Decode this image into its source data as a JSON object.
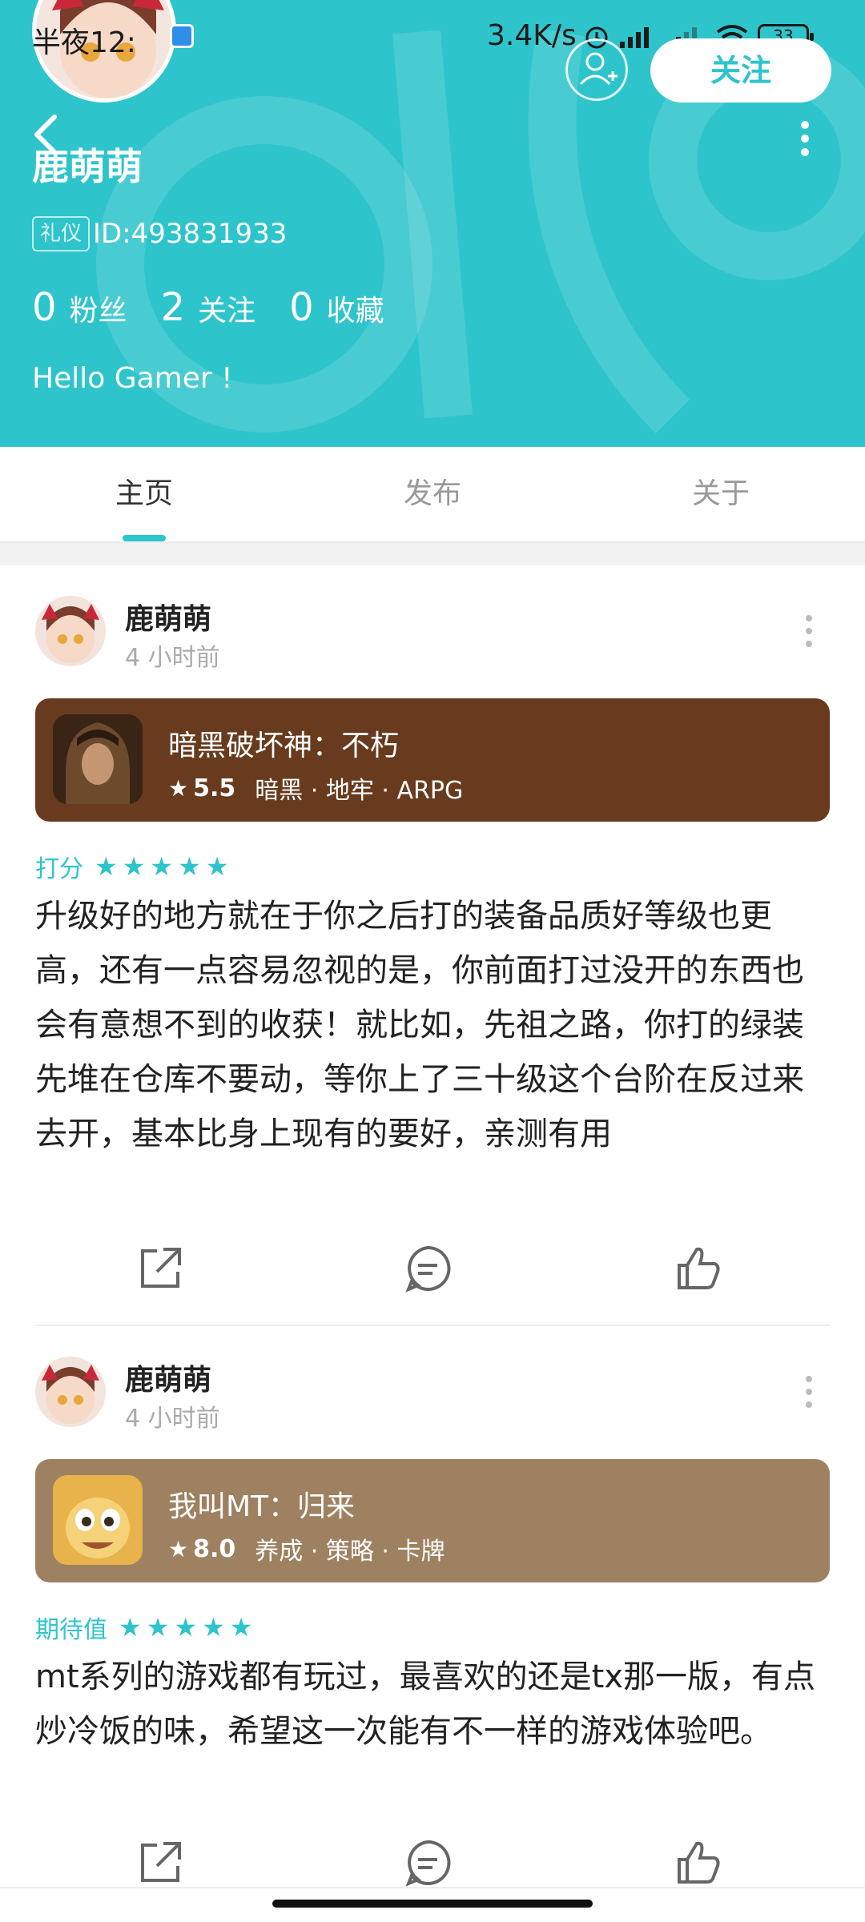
{
  "status_bar": {
    "time": "半夜12:",
    "speed": "3.4K/s",
    "battery": "33"
  },
  "profile": {
    "name": "鹿萌萌",
    "title_badge": "礼仪",
    "id": "ID:493831933",
    "follow_label": "关注",
    "stats": [
      {
        "num": "0",
        "label": "粉丝"
      },
      {
        "num": "2",
        "label": "关注"
      },
      {
        "num": "0",
        "label": "收藏"
      }
    ],
    "bio": "Hello Gamer !"
  },
  "tabs": [
    {
      "label": "主页",
      "active": true
    },
    {
      "label": "发布",
      "active": false
    },
    {
      "label": "关于",
      "active": false
    }
  ],
  "posts": [
    {
      "author": "鹿萌萌",
      "time": "4 小时前",
      "game": {
        "name": "暗黑破坏神：不朽",
        "score": "5.5",
        "tags": "暗黑 · 地牢 · ARPG",
        "card_color": "#683b1e"
      },
      "rating_label": "打分",
      "stars": 5,
      "body": "升级好的地方就在于你之后打的装备品质好等级也更高，还有一点容易忽视的是，你前面打过没开的东西也会有意想不到的收获！就比如，先祖之路，你打的绿装先堆在仓库不要动，等你上了三十级这个台阶在反过来去开，基本比身上现有的要好，亲测有用"
    },
    {
      "author": "鹿萌萌",
      "time": "4 小时前",
      "game": {
        "name": "我叫MT：归来",
        "score": "8.0",
        "tags": "养成 · 策略 · 卡牌",
        "card_color": "#9e8160"
      },
      "rating_label": "期待值",
      "stars": 5,
      "body": "mt系列的游戏都有玩过，最喜欢的还是tx那一版，有点炒冷饭的味，希望这一次能有不一样的游戏体验吧。"
    }
  ],
  "colors": {
    "accent": "#2ec4cc",
    "header_bg": "#2ec4cc"
  },
  "icons": [
    "back-icon",
    "add-user-icon",
    "more-vertical-icon",
    "share-icon",
    "comment-icon",
    "like-icon",
    "star-icon"
  ]
}
